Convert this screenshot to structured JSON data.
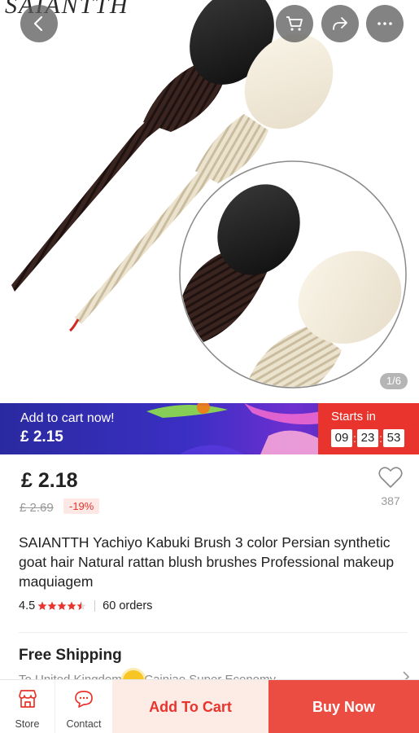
{
  "header": {
    "brand_text": "SAIANTTH",
    "icons": [
      "back-arrow-icon",
      "cart-icon",
      "share-icon",
      "more-icon"
    ]
  },
  "gallery": {
    "pager_text": "1/6"
  },
  "promo": {
    "title": "Add to cart now!",
    "price": "£ 2.15",
    "starts_label": "Starts in",
    "timer": {
      "hours": "09",
      "minutes": "23",
      "seconds": "53"
    },
    "accent_color": "#e8342c"
  },
  "pricing": {
    "price": "£ 2.18",
    "original_price": "£ 2.69",
    "discount": "-19%",
    "wishlist_count": "387"
  },
  "product": {
    "title": "SAIANTTH Yachiyo Kabuki Brush 3 color Persian synthetic goat hair Natural rattan blush brushes Professional makeup maquiagem",
    "rating": "4.5",
    "stars": 4.5,
    "orders": "60 orders"
  },
  "shipping": {
    "title": "Free Shipping",
    "subtitle": "To United Kingdom via Cainiao Super Economy"
  },
  "bottom_bar": {
    "store_label": "Store",
    "contact_label": "Contact",
    "add_to_cart_label": "Add To Cart",
    "buy_now_label": "Buy Now"
  },
  "colors": {
    "accent": "#e8342c",
    "buy_button": "#ec4d42",
    "add_button_bg": "#fdece6",
    "star": "#e8342c"
  }
}
